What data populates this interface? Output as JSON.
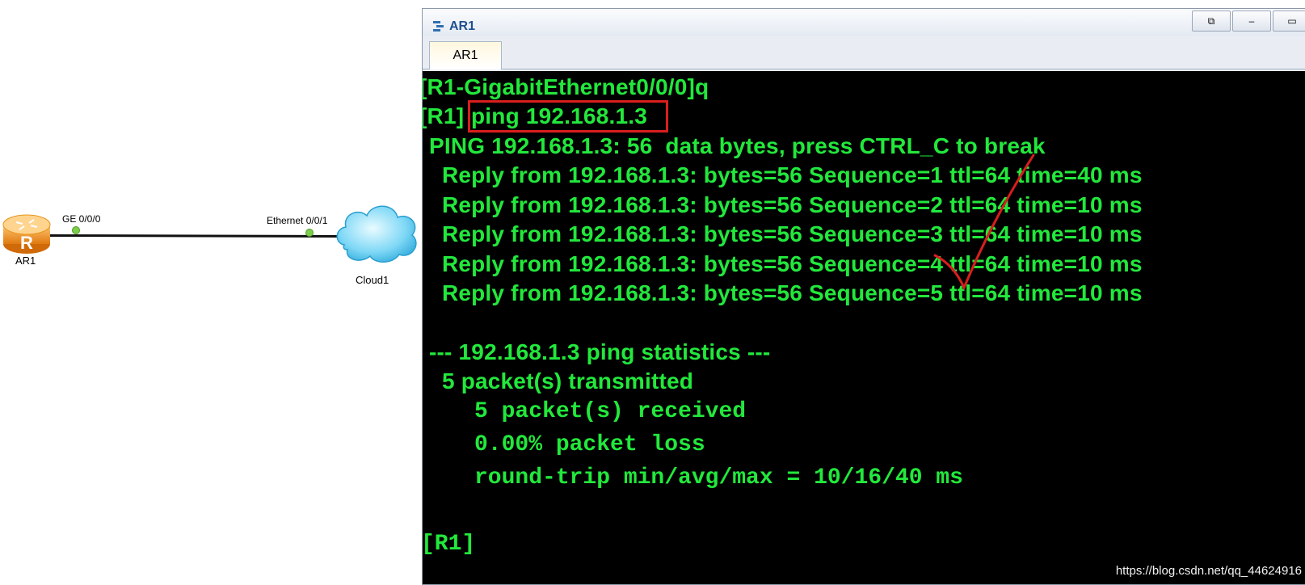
{
  "topology": {
    "router": {
      "name": "AR1",
      "port": "GE 0/0/0",
      "icon": "router-icon"
    },
    "cloud": {
      "name": "Cloud1",
      "port": "Ethernet 0/0/1",
      "icon": "cloud-icon"
    }
  },
  "window": {
    "title": "AR1",
    "tab_label": "AR1",
    "restore_glyph": "⧉",
    "minimize_glyph": "–",
    "maximize_glyph": "▭"
  },
  "terminal": {
    "lines": [
      "[R1-GigabitEthernet0/0/0]q",
      "[R1]",
      "ping 192.168.1.3",
      " PING 192.168.1.3: 56  data bytes, press CTRL_C to break",
      "   Reply from 192.168.1.3: bytes=56 Sequence=1 ttl=64 time=40 ms",
      "   Reply from 192.168.1.3: bytes=56 Sequence=2 ttl=64 time=10 ms",
      "   Reply from 192.168.1.3: bytes=56 Sequence=3 ttl=64 time=10 ms",
      "   Reply from 192.168.1.3: bytes=56 Sequence=4 ttl=64 time=10 ms",
      "   Reply from 192.168.1.3: bytes=56 Sequence=5 ttl=64 time=10 ms",
      " --- 192.168.1.3 ping statistics ---",
      "   5 packet(s) transmitted",
      "5 packet(s) received",
      "0.00% packet loss",
      "round-trip min/avg/max = 10/16/40 ms",
      "[R1]"
    ]
  },
  "watermark": "https://blog.csdn.net/qq_44624916",
  "colors": {
    "terminal_text": "#22e83c",
    "terminal_bg": "#000000",
    "annotation": "#d81e1e"
  }
}
